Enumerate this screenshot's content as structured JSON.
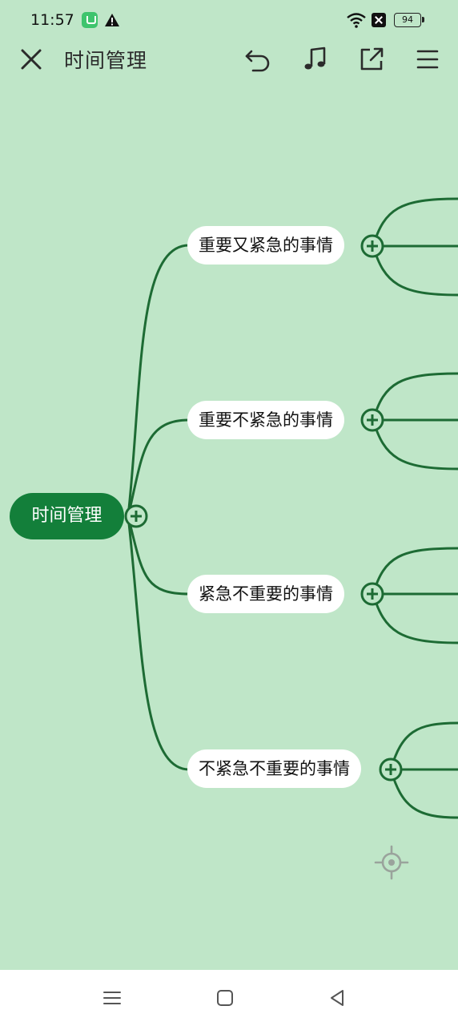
{
  "status_bar": {
    "time": "11:57",
    "battery": "94",
    "icons": [
      "app-notification-icon",
      "warning-icon",
      "wifi-icon",
      "sim-off-icon",
      "battery-icon"
    ]
  },
  "toolbar": {
    "title": "时间管理",
    "icons": [
      "close-icon",
      "undo-icon",
      "music-note-icon",
      "share-icon",
      "menu-icon"
    ]
  },
  "mindmap": {
    "root": "时间管理",
    "topics": [
      {
        "label": "重要又紧急的事情"
      },
      {
        "label": "重要不紧急的事情"
      },
      {
        "label": "紧急不重要的事情"
      },
      {
        "label": "不紧急不重要的事情"
      }
    ]
  },
  "colors": {
    "background": "#bfe6c8",
    "accent": "#137f3a",
    "line": "#1d6b34",
    "node": "#ffffff"
  },
  "nav_bar": {
    "icons": [
      "menu-icon",
      "home-square-icon",
      "back-triangle-icon"
    ]
  }
}
